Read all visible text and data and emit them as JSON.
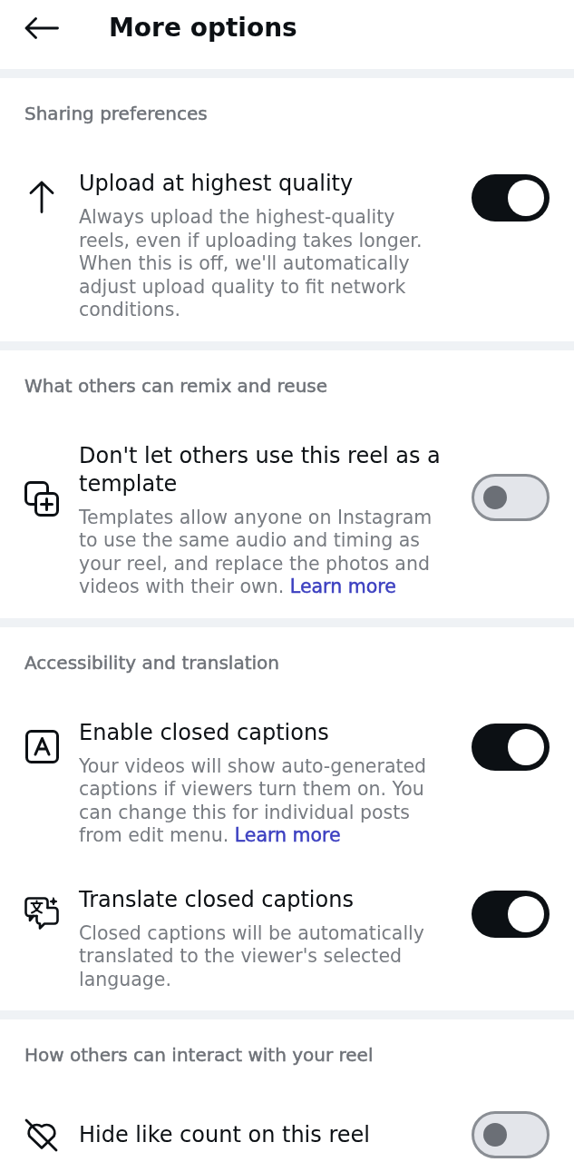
{
  "header": {
    "title": "More options"
  },
  "sections": [
    {
      "heading": "Sharing preferences",
      "items": [
        {
          "title": "Upload at highest quality",
          "description": "Always upload the highest-quality reels, even if uploading takes longer. When this is off, we'll automatically adjust upload quality to fit network conditions.",
          "on": true
        }
      ]
    },
    {
      "heading": "What others can remix and reuse",
      "items": [
        {
          "title": "Don't let others use this reel as a template",
          "description": "Templates allow anyone on Instagram to use the same audio and timing as your reel, and replace the photos and videos with their own.",
          "link": "Learn more",
          "on": false
        }
      ]
    },
    {
      "heading": "Accessibility and translation",
      "items": [
        {
          "title": "Enable closed captions",
          "description": "Your videos will show auto-generated captions if viewers turn them on. You can change this for individual posts from edit menu.",
          "link": "Learn more",
          "on": true
        },
        {
          "title": "Translate closed captions",
          "description": "Closed captions will be automatically translated to the viewer's selected language.",
          "on": true
        }
      ]
    },
    {
      "heading": "How others can interact with your reel",
      "items": [
        {
          "title": "Hide like count on this reel",
          "on": false
        }
      ]
    }
  ]
}
